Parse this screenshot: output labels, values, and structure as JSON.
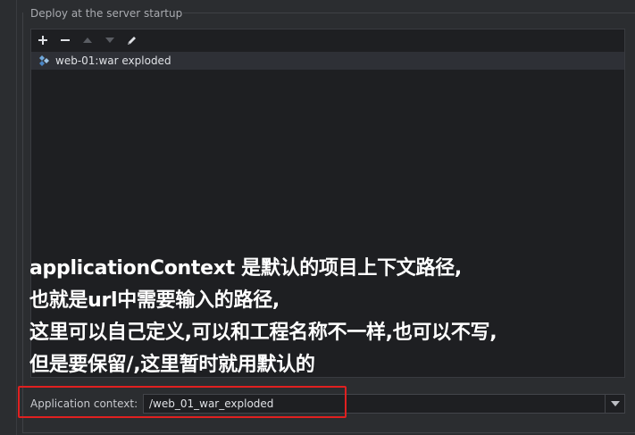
{
  "group": {
    "title": "Deploy at the server startup"
  },
  "toolbar": {
    "add_icon": "plus-icon",
    "remove_icon": "minus-icon",
    "move_up_icon": "arrow-up-icon",
    "move_down_icon": "arrow-down-icon",
    "edit_icon": "pencil-icon"
  },
  "deployments": [
    {
      "label": "web-01:war exploded",
      "icon": "artifact-icon"
    }
  ],
  "annotation": {
    "lines": [
      "applicationContext 是默认的项目上下文路径,",
      "也就是url中需要输入的路径,",
      "这里可以自己定义,可以和工程名称不一样,也可以不写,",
      "但是要保留/,这里暂时就用默认的"
    ],
    "color": "#ffffff"
  },
  "application_context": {
    "label": "Application context:",
    "value": "/web_01_war_exploded"
  },
  "colors": {
    "background": "#2b2d30",
    "list_background": "#1e1f22",
    "selected_row": "#2e3036",
    "highlight": "#e02020"
  }
}
